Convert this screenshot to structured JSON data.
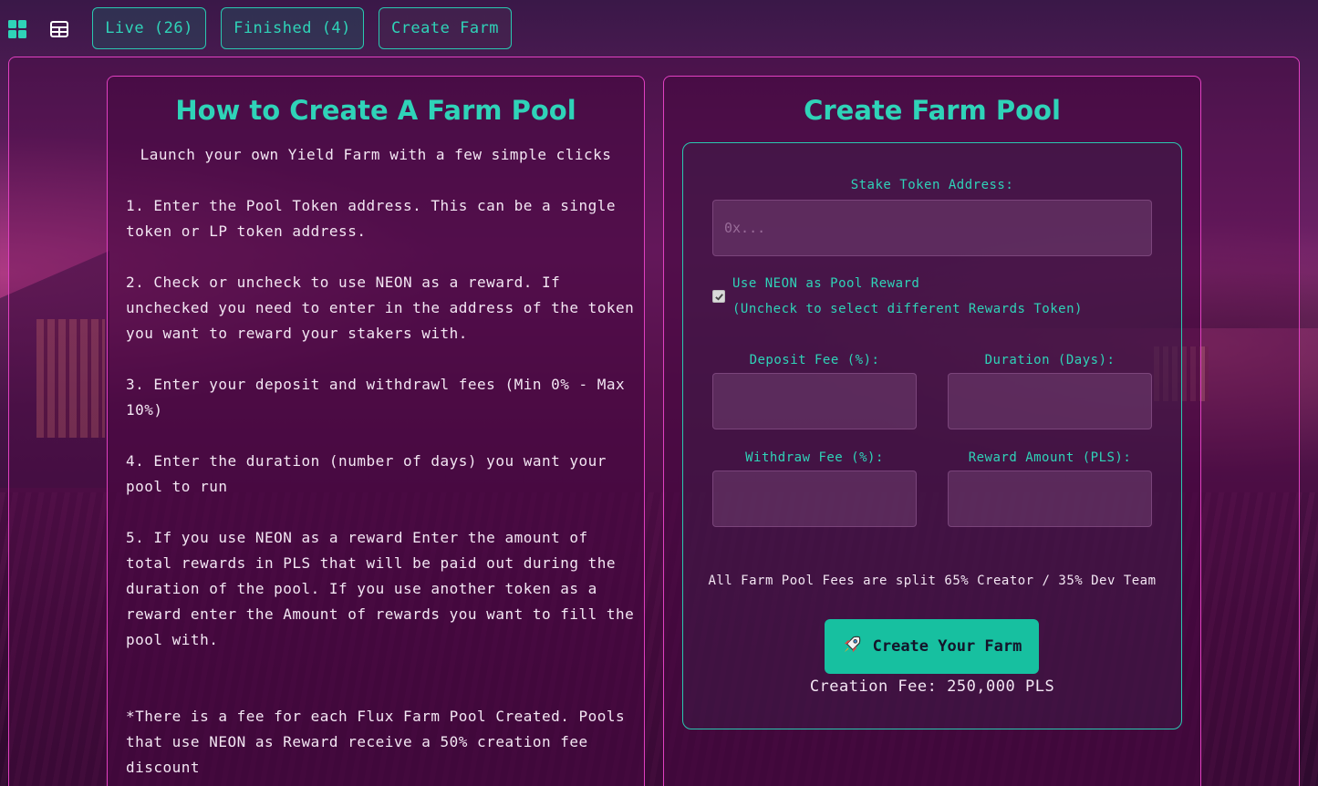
{
  "toolbar": {
    "grid_icon": "grid-view-icon",
    "list_icon": "table-view-icon",
    "tabs": [
      {
        "label": "Live (26)"
      },
      {
        "label": "Finished (4)"
      },
      {
        "label": "Create Farm"
      }
    ]
  },
  "guide": {
    "title": "How to Create A Farm Pool",
    "intro": "Launch your own Yield Farm with a few simple clicks",
    "steps": [
      "1. Enter the Pool Token address. This can be a single token or LP token address.",
      "2. Check or uncheck to use NEON as a reward. If unchecked you need to enter in the address of the token you want to reward your stakers with.",
      "3. Enter your deposit and withdrawl fees (Min 0% - Max 10%)",
      "4. Enter the duration (number of days) you want your pool to run",
      "5. If you use NEON as a reward Enter the amount of total rewards in PLS that will be paid out during the duration of the pool. If you use another token as a reward enter the Amount of rewards you want to fill the pool with."
    ],
    "note": "*There is a fee for each Flux Farm Pool Created. Pools that use NEON as Reward receive a 50% creation fee discount"
  },
  "form": {
    "title": "Create Farm Pool",
    "stake_label": "Stake Token Address:",
    "stake_placeholder": "0x...",
    "use_neon_label": "Use NEON as Pool Reward",
    "use_neon_hint": "(Uncheck to select different Rewards Token)",
    "use_neon_checked": true,
    "deposit_fee_label": "Deposit Fee (%):",
    "duration_label": "Duration (Days):",
    "withdraw_fee_label": "Withdraw Fee (%):",
    "reward_amount_label": "Reward Amount (PLS):",
    "split_note": "All Farm Pool Fees are split 65% Creator / 35% Dev Team",
    "create_button": "Create Your Farm",
    "create_icon": "rocket-icon",
    "creation_fee": "Creation Fee: 250,000 PLS"
  },
  "colors": {
    "accent": "#2fd3b8",
    "border_pink": "#e040c0",
    "button_bg": "#17c0a0"
  }
}
